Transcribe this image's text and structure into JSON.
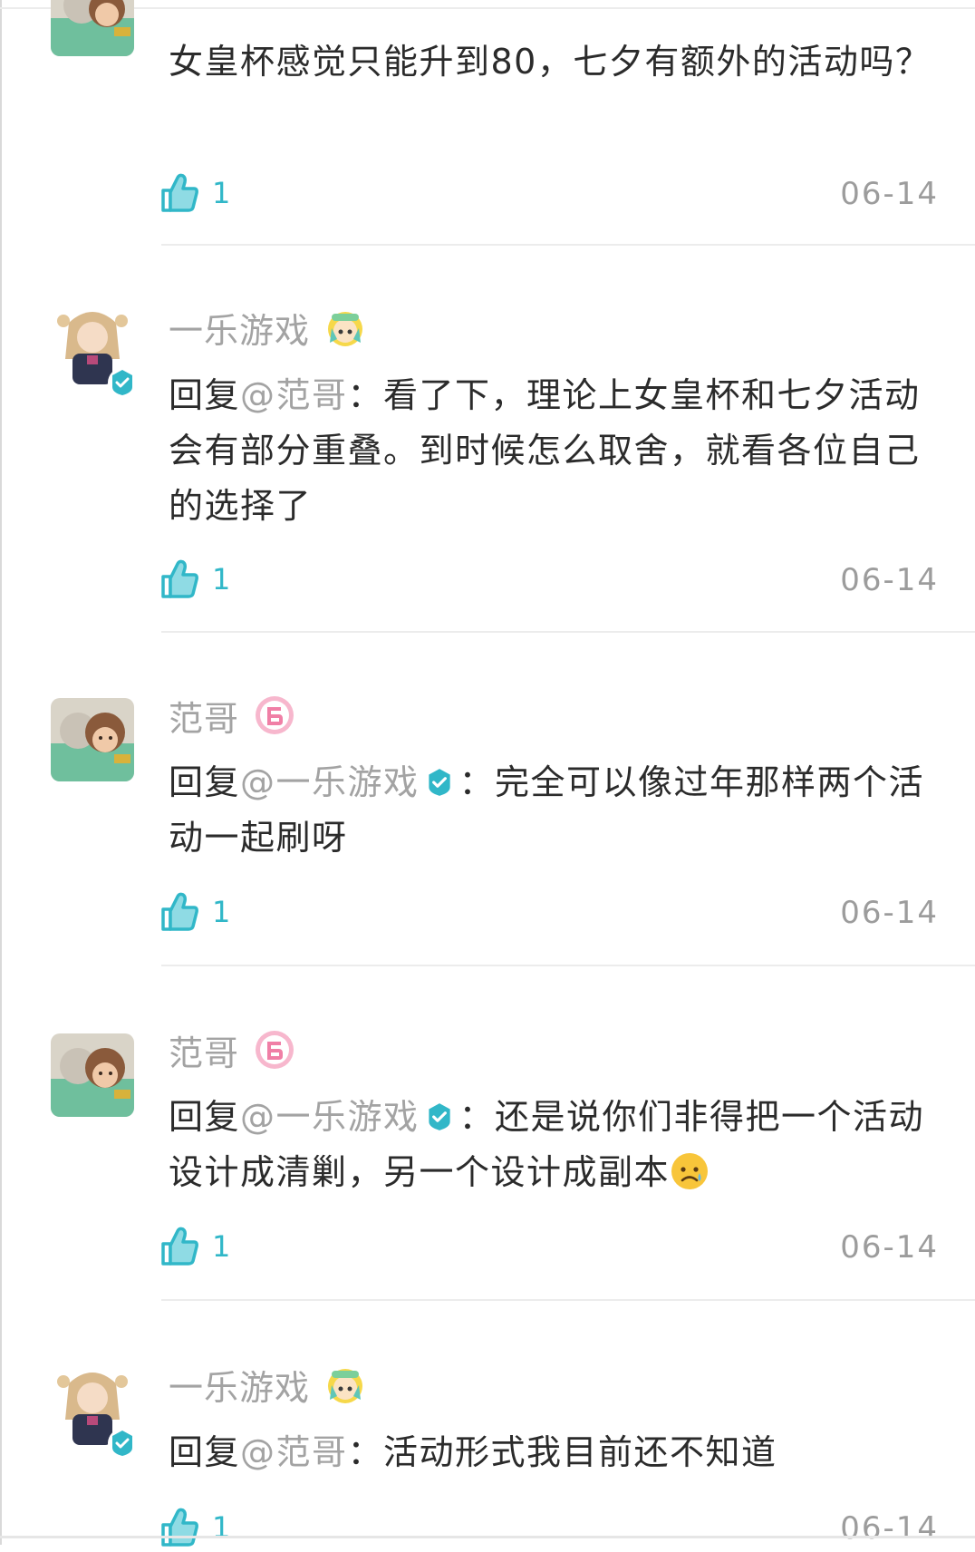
{
  "comments": [
    {
      "user": "",
      "text": "女皇杯感觉只能升到80，七夕有额外的活动吗？",
      "likes": "1",
      "date": "06-14"
    },
    {
      "user": "一乐游戏",
      "reply_prefix": "回复",
      "mention": "@范哥",
      "text": "：看了下，理论上女皇杯和七夕活动会有部分重叠。到时候怎么取舍，就看各位自己的选择了",
      "likes": "1",
      "date": "06-14"
    },
    {
      "user": "范哥",
      "reply_prefix": "回复",
      "mention": "@一乐游戏",
      "text": "：完全可以像过年那样两个活动一起刷呀",
      "likes": "1",
      "date": "06-14"
    },
    {
      "user": "范哥",
      "reply_prefix": "回复",
      "mention": "@一乐游戏",
      "text": "：还是说你们非得把一个活动设计成清剿，另一个设计成副本",
      "emoji": "sad-face-emoji",
      "likes": "1",
      "date": "06-14"
    },
    {
      "user": "一乐游戏",
      "reply_prefix": "回复",
      "mention": "@范哥",
      "text": "：活动形式我目前还不知道",
      "likes": "1",
      "date": "06-14"
    }
  ],
  "colors": {
    "accent": "#31b7c8",
    "muted_text": "#a3a3a3",
    "body_text": "#2b2b2b",
    "badge_pink": "#f07fa6",
    "divider": "#ececec"
  }
}
